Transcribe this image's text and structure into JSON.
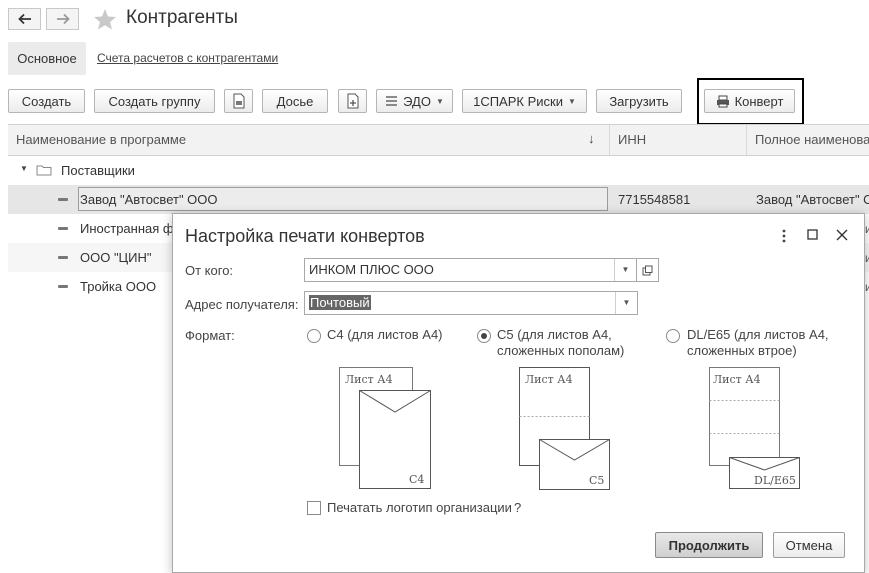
{
  "window": {
    "title": "Контрагенты"
  },
  "tabs": [
    {
      "label": "Основное"
    },
    {
      "label": "Счета расчетов с контрагентами"
    }
  ],
  "toolbar": {
    "create_label": "Создать",
    "create_group_label": "Создать группу",
    "dossier_label": "Досье",
    "edo_label": "ЭДО",
    "spark_label": "1СПАРК Риски",
    "load_label": "Загрузить",
    "envelope_label": "Конверт"
  },
  "table": {
    "columns": [
      "Наименование в программе",
      "ИНН",
      "Полное наименова"
    ],
    "group": {
      "name": "Поставщики"
    },
    "rows": [
      {
        "name": "Завод \"Автосвет\" ООО",
        "inn": "7715548581",
        "full": "Завод \"Автосвет\" О"
      },
      {
        "name": "Иностранная фи",
        "inn": "",
        "full": ""
      },
      {
        "name": "ООО \"ЦИН\"",
        "inn": "",
        "full": ""
      },
      {
        "name": "Тройка ООО",
        "inn": "",
        "full": ""
      }
    ]
  },
  "dialog": {
    "title": "Настройка печати конвертов",
    "from_label": "От кого:",
    "from_value": "ИНКОМ ПЛЮС ООО",
    "address_label": "Адрес получателя:",
    "address_value": "Почтовый",
    "format_label": "Формат:",
    "formats": [
      {
        "line1": "С4 (для листов А4)",
        "line2": "",
        "selected": false
      },
      {
        "line1": "С5 (для листов А4,",
        "line2": "сложенных пополам)",
        "selected": true
      },
      {
        "line1": "DL/E65 (для листов А4,",
        "line2": "сложенных втрое)",
        "selected": false
      }
    ],
    "illustrations": {
      "sheet_label": "Лист А4",
      "c4": "C4",
      "c5": "C5",
      "dl": "DL/E65"
    },
    "print_logo_label": "Печатать логотип организации",
    "print_logo_help": "?",
    "print_logo_checked": false,
    "continue_label": "Продолжить",
    "cancel_label": "Отмена"
  },
  "icons": [
    "back-arrow-icon",
    "forward-arrow-icon",
    "favorite-star-icon",
    "printer-icon",
    "folder-icon",
    "menu-dots-icon",
    "maximize-icon",
    "close-icon"
  ]
}
